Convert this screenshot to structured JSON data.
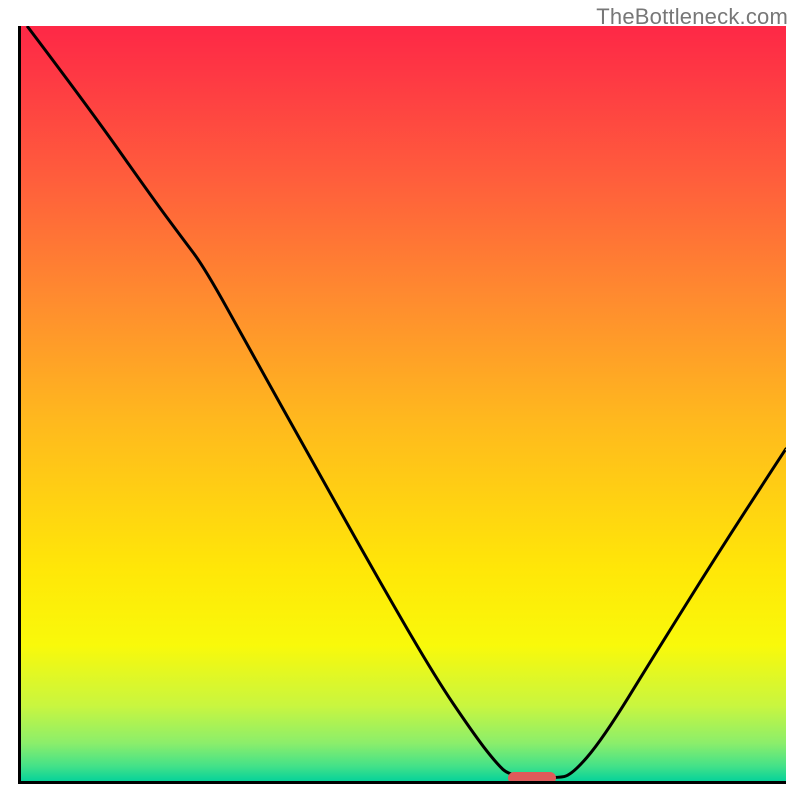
{
  "watermark": "TheBottleneck.com",
  "plot": {
    "viewW": 768,
    "viewH": 758
  },
  "marker": {
    "color": "#e05a5a",
    "x_frac": 0.665,
    "y_frac": 0.992,
    "w_frac": 0.062,
    "h_frac": 0.016
  },
  "curve": {
    "stroke": "#000000",
    "width": 3,
    "points_frac": [
      [
        0.008,
        0.0
      ],
      [
        0.09,
        0.11
      ],
      [
        0.17,
        0.225
      ],
      [
        0.21,
        0.28
      ],
      [
        0.24,
        0.32
      ],
      [
        0.3,
        0.43
      ],
      [
        0.38,
        0.575
      ],
      [
        0.46,
        0.72
      ],
      [
        0.54,
        0.86
      ],
      [
        0.59,
        0.935
      ],
      [
        0.62,
        0.975
      ],
      [
        0.64,
        0.994
      ],
      [
        0.7,
        0.996
      ],
      [
        0.72,
        0.992
      ],
      [
        0.76,
        0.945
      ],
      [
        0.83,
        0.83
      ],
      [
        0.91,
        0.7
      ],
      [
        1.0,
        0.56
      ]
    ]
  },
  "chart_data": {
    "type": "line",
    "title": "",
    "xlabel": "",
    "ylabel": "",
    "x": [
      0.01,
      0.09,
      0.17,
      0.21,
      0.24,
      0.3,
      0.38,
      0.46,
      0.54,
      0.59,
      0.62,
      0.64,
      0.7,
      0.72,
      0.76,
      0.83,
      0.91,
      1.0
    ],
    "values": [
      100,
      89,
      78,
      72,
      68,
      57,
      43,
      28,
      14,
      7,
      3,
      1,
      0,
      1,
      6,
      17,
      30,
      44
    ],
    "xlim": [
      0,
      1
    ],
    "ylim": [
      0,
      100
    ],
    "optimum_marker_x": 0.68,
    "annotations": [
      "watermark: TheBottleneck.com"
    ],
    "background": "vertical heatmap gradient red→green (green = low / good)"
  }
}
